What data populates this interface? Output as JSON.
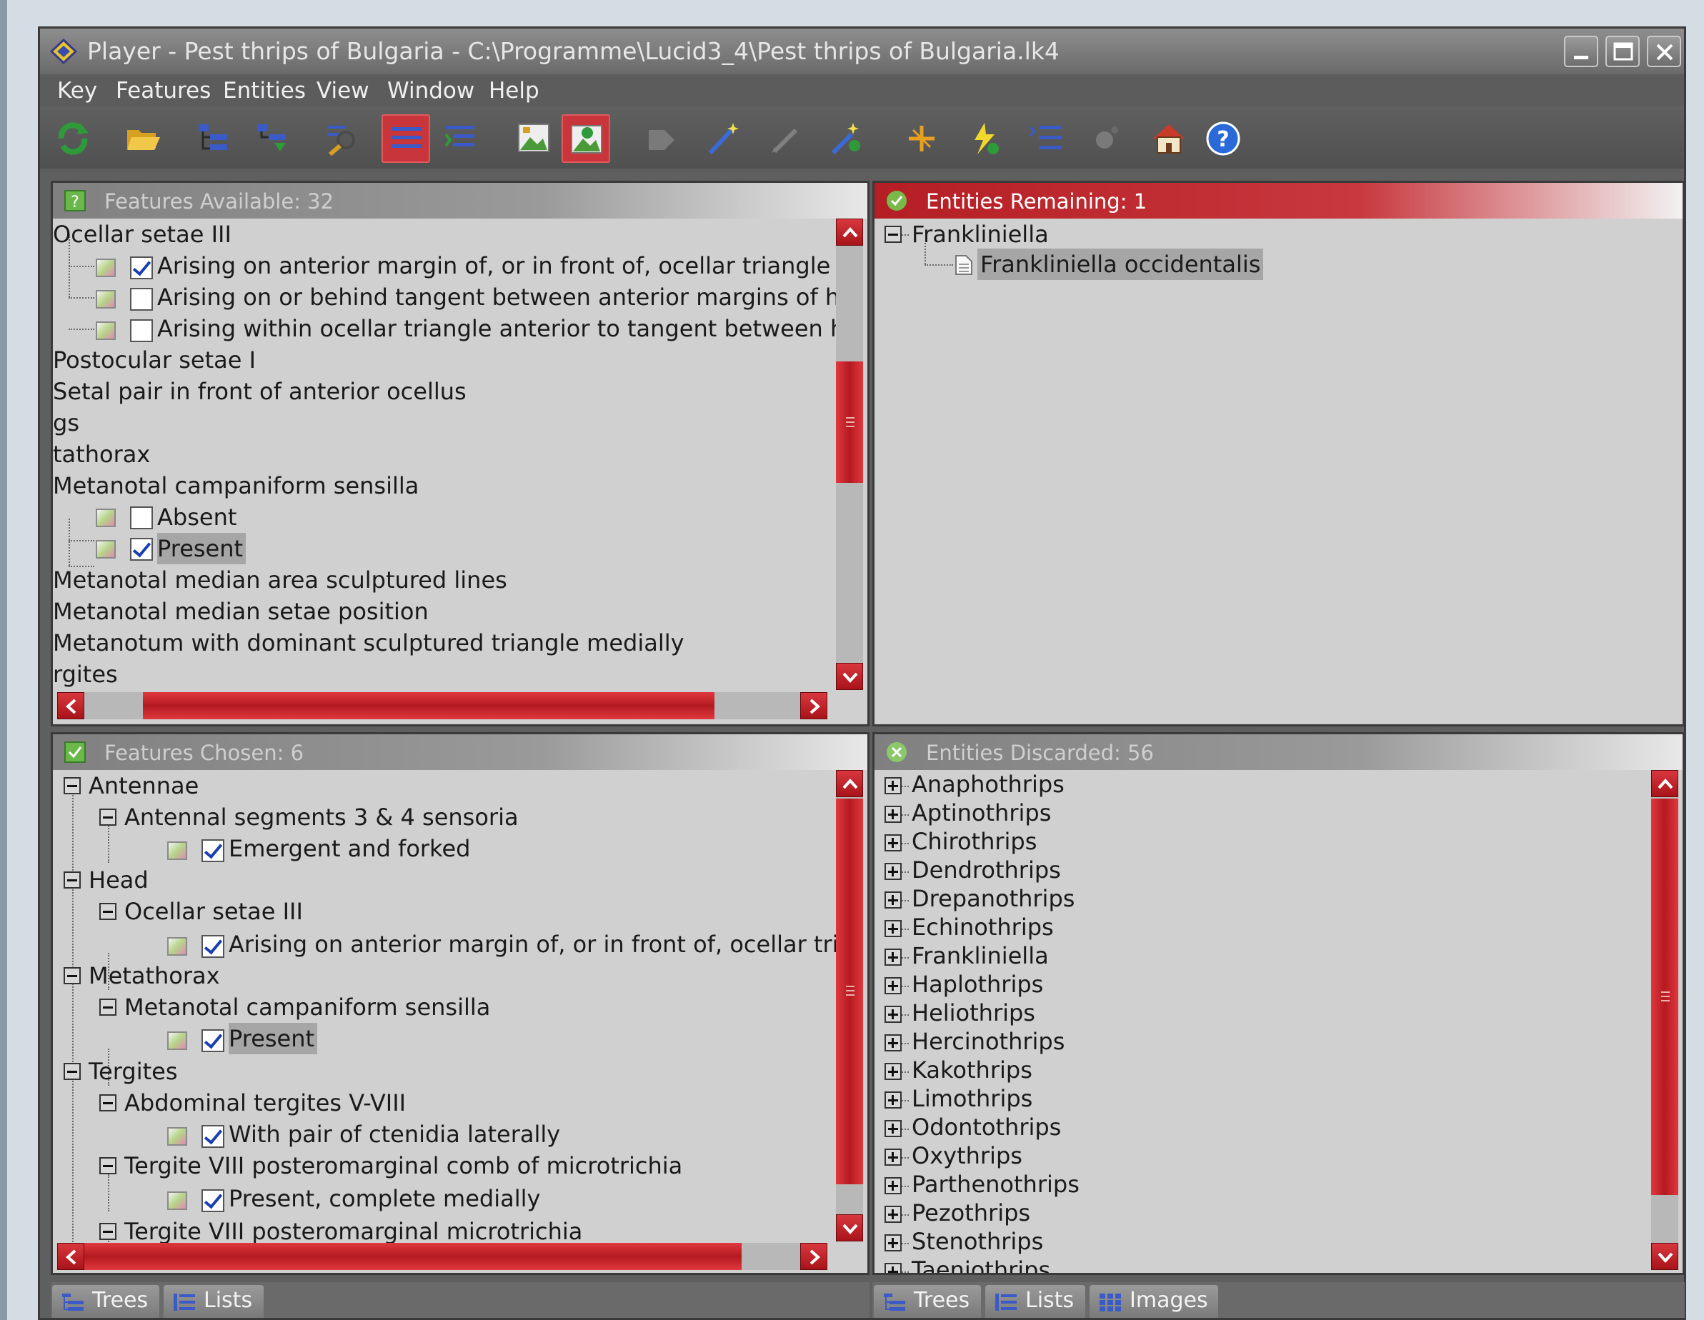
{
  "window": {
    "title": "Player - Pest thrips of Bulgaria - C:\\Programme\\Lucid3_4\\Pest thrips of Bulgaria.lk4"
  },
  "menu": [
    "Key",
    "Features",
    "Entities",
    "View",
    "Window",
    "Help"
  ],
  "features_available": {
    "header": "Features Available: 32",
    "rows": [
      {
        "text": "Ocellar setae III"
      },
      {
        "text": "Arising on anterior margin of, or in front of, ocellar triangle",
        "checked": true
      },
      {
        "text": "Arising on or behind tangent between anterior margins of h",
        "checked": false
      },
      {
        "text": "Arising within ocellar triangle anterior to tangent between h",
        "checked": false
      },
      {
        "text": "Postocular setae I"
      },
      {
        "text": "Setal pair in front of anterior ocellus"
      },
      {
        "text": "gs"
      },
      {
        "text": "tathorax"
      },
      {
        "text": "Metanotal campaniform sensilla"
      },
      {
        "text": "Absent",
        "checked": false
      },
      {
        "text": "Present",
        "checked": true
      },
      {
        "text": "Metanotal median area sculptured lines"
      },
      {
        "text": "Metanotal median setae position"
      },
      {
        "text": "Metanotum with dominant sculptured triangle medially"
      },
      {
        "text": "rgites"
      }
    ]
  },
  "entities_remaining": {
    "header": "Entities Remaining: 1",
    "rows": [
      "Frankliniella",
      "Frankliniella occidentalis"
    ]
  },
  "features_chosen": {
    "header": "Features Chosen: 6",
    "rows": [
      "Antennae",
      "Antennal segments 3 & 4 sensoria",
      "Emergent and forked",
      "Head",
      "Ocellar setae III",
      "Arising on anterior margin of, or in front of, ocellar tria",
      "Metathorax",
      "Metanotal campaniform sensilla",
      "Present",
      "Tergites",
      "Abdominal tergites V-VIII",
      "With pair of ctenidia laterally",
      "Tergite VIII posteromarginal comb of microtrichia",
      "Present, complete medially",
      "Tergite VIII posteromarginal microtrichia"
    ]
  },
  "entities_discarded": {
    "header": "Entities Discarded: 56",
    "rows": [
      "Anaphothrips",
      "Aptinothrips",
      "Chirothrips",
      "Dendrothrips",
      "Drepanothrips",
      "Echinothrips",
      "Frankliniella",
      "Haplothrips",
      "Heliothrips",
      "Hercinothrips",
      "Kakothrips",
      "Limothrips",
      "Odontothrips",
      "Oxythrips",
      "Parthenothrips",
      "Pezothrips",
      "Stenothrips",
      "Taeniothrips"
    ]
  },
  "tabs_left": [
    "Trees",
    "Lists"
  ],
  "tabs_right": [
    "Trees",
    "Lists",
    "Images"
  ]
}
